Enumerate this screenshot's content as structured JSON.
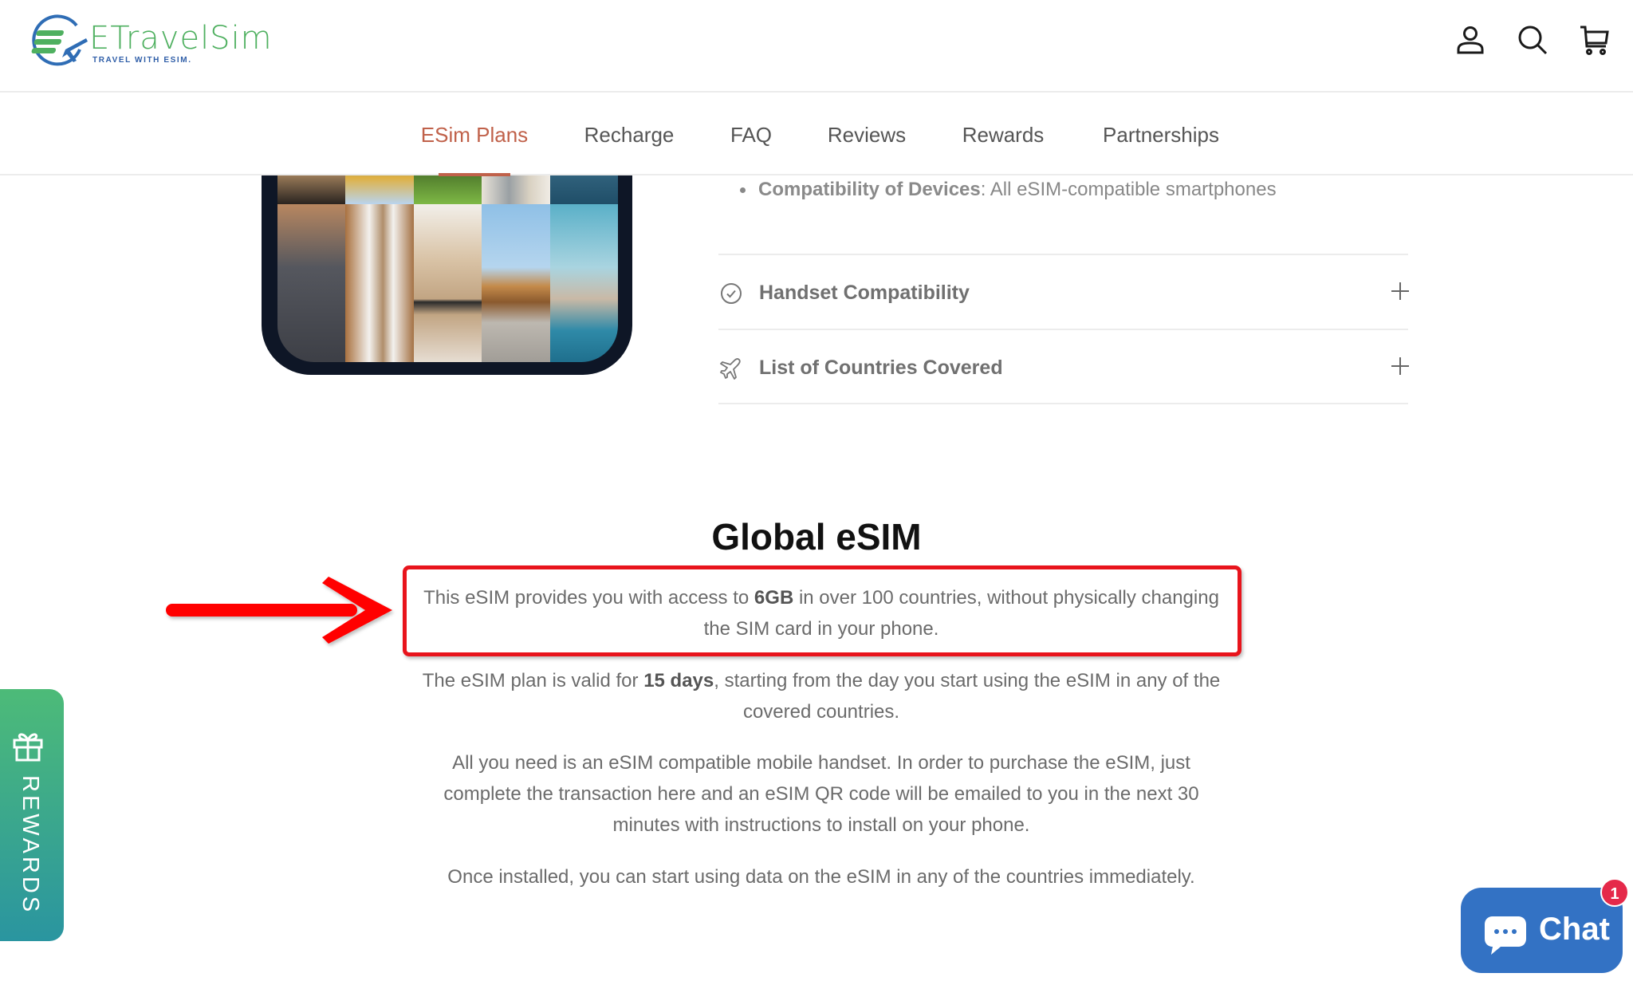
{
  "header": {
    "logo_text": "ETravelSim",
    "logo_tagline": "TRAVEL WITH ESIM.",
    "icons": [
      "account-icon",
      "search-icon",
      "cart-icon"
    ]
  },
  "nav": {
    "items": [
      {
        "label": "ESim Plans",
        "active": true
      },
      {
        "label": "Recharge",
        "active": false
      },
      {
        "label": "FAQ",
        "active": false
      },
      {
        "label": "Reviews",
        "active": false
      },
      {
        "label": "Rewards",
        "active": false
      },
      {
        "label": "Partnerships",
        "active": false
      }
    ],
    "active_color": "#c0614a"
  },
  "product": {
    "bullet": {
      "label": "Compatibility of Devices",
      "value": ": All eSIM-compatible smartphones"
    },
    "accordions": [
      {
        "label": "Handset Compatibility",
        "icon": "check-circle-icon"
      },
      {
        "label": "List of Countries Covered",
        "icon": "airplane-icon"
      }
    ]
  },
  "description": {
    "title": "Global eSIM",
    "paragraphs": [
      {
        "before": "This eSIM provides you with access to ",
        "bold": "6GB",
        "after": " in over 100 countries, without physically changing the SIM card in your phone."
      },
      {
        "before": "The eSIM plan is valid for ",
        "bold": "15 days",
        "after": ", starting from the day you start using the eSIM in any of the covered countries."
      },
      {
        "text": "All you need is an eSIM compatible mobile handset. In order to purchase the eSIM, just complete the transaction here and an eSIM QR code will be emailed to you in the next 30 minutes with instructions to install on your phone."
      },
      {
        "text": "Once installed, you can start using data on the eSIM in any of the countries immediately."
      }
    ]
  },
  "annotation": {
    "color": "#e8141c",
    "shape": "arrow pointing to highlighted paragraph"
  },
  "rewards_tab": {
    "label": "REWARDS"
  },
  "chat": {
    "label": "Chat",
    "badge_count": "1",
    "color": "#3372c4",
    "badge_color": "#e5294a"
  }
}
